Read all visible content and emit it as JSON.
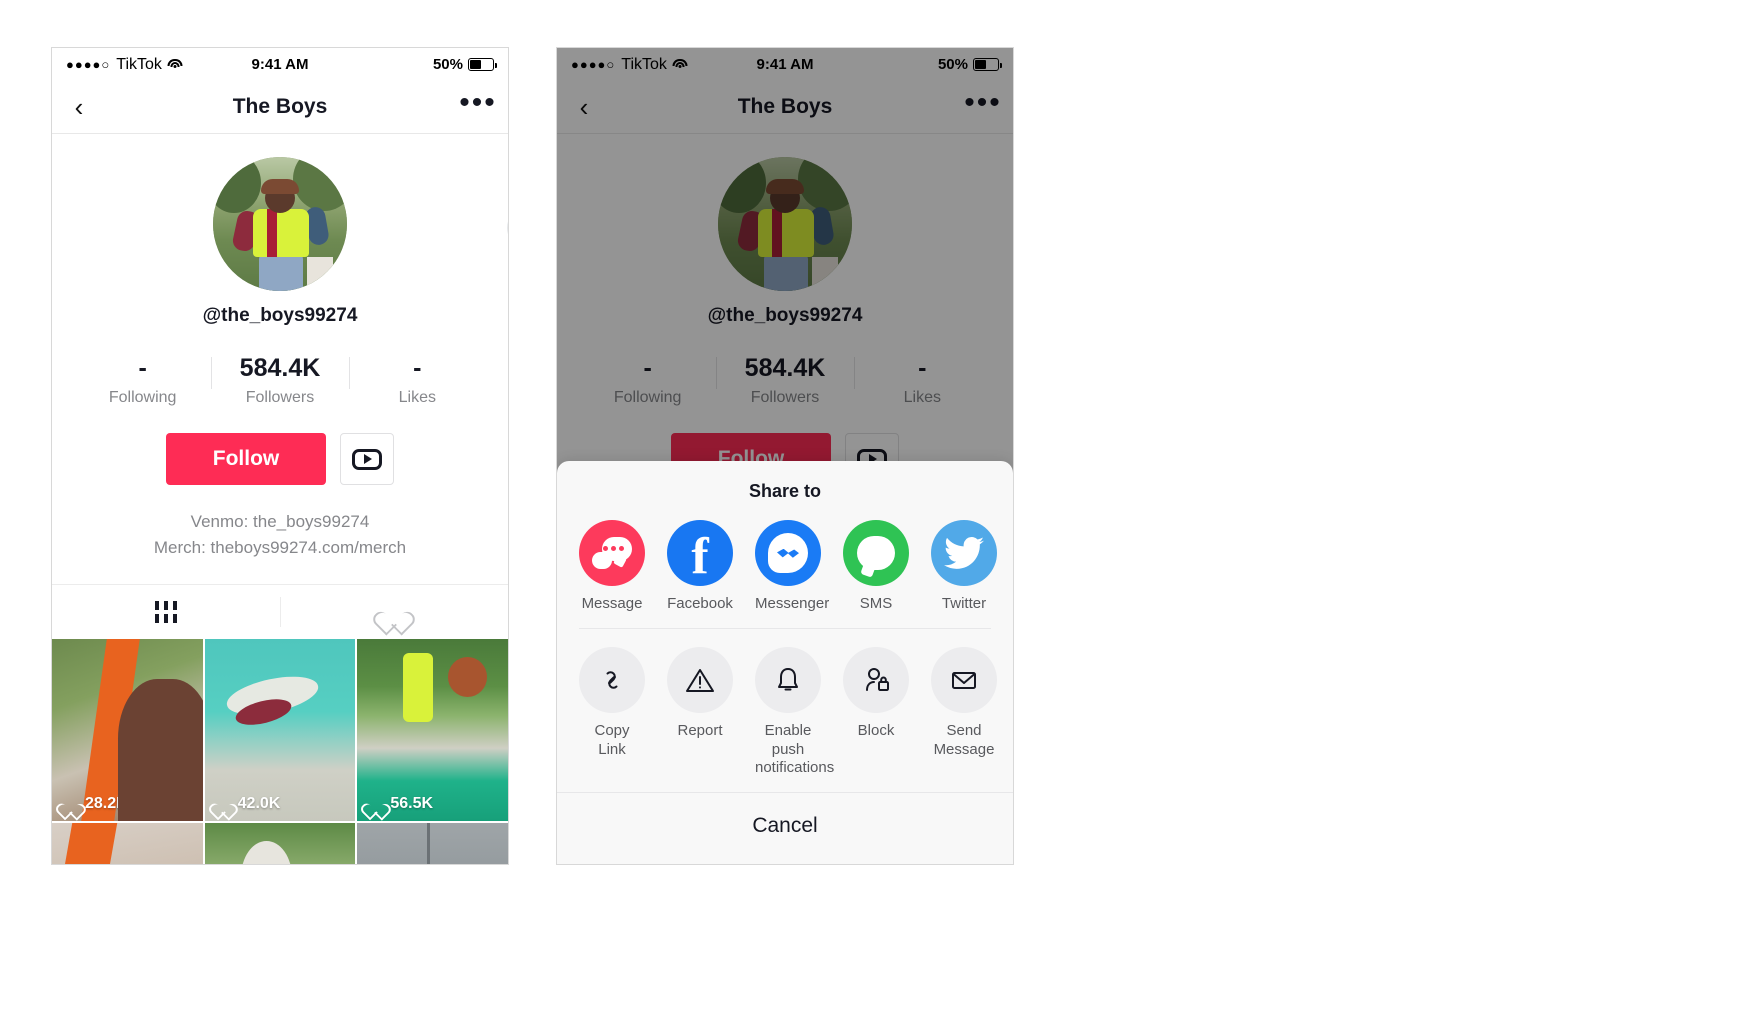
{
  "status_bar": {
    "signal_dots": "●●●●○",
    "carrier": "TikTok",
    "wifi_icon": "wifi-icon",
    "time": "9:41 AM",
    "battery_text": "50%",
    "battery_level": 50
  },
  "nav": {
    "back_icon": "chevron-left-icon",
    "title": "The Boys",
    "more_icon": "more-horizontal-icon",
    "more_label": "•••"
  },
  "profile": {
    "avatar_alt": "profile-photo",
    "handle": "@the_boys99274",
    "stats": [
      {
        "value": "-",
        "label": "Following"
      },
      {
        "value": "584.4K",
        "label": "Followers"
      },
      {
        "value": "-",
        "label": "Likes"
      }
    ],
    "follow_label": "Follow",
    "youtube_icon": "youtube-play-icon",
    "bio_line1": "Venmo: the_boys99274",
    "bio_line2": "Merch: theboys99274.com/merch",
    "tabs": [
      {
        "icon": "grid-icon",
        "active": true
      },
      {
        "icon": "heart-icon",
        "active": false
      }
    ]
  },
  "videos": [
    {
      "likes": "28.2K",
      "heart_icon": "heart-icon"
    },
    {
      "likes": "42.0K",
      "heart_icon": "heart-icon"
    },
    {
      "likes": "56.5K",
      "heart_icon": "heart-icon"
    },
    {
      "likes": "",
      "heart_icon": "heart-icon"
    },
    {
      "likes": "",
      "heart_icon": "heart-icon"
    },
    {
      "likes": "",
      "heart_icon": "heart-icon"
    }
  ],
  "share_sheet": {
    "title": "Share to",
    "share_targets": [
      {
        "label": "Message",
        "icon": "imessage-icon",
        "color": "#fd3a5c"
      },
      {
        "label": "Facebook",
        "icon": "facebook-icon",
        "color": "#1877f2"
      },
      {
        "label": "Messenger",
        "icon": "messenger-icon",
        "color": "#1a7bf5"
      },
      {
        "label": "SMS",
        "icon": "sms-icon",
        "color": "#2fc354"
      },
      {
        "label": "Twitter",
        "icon": "twitter-icon",
        "color": "#51a9e8"
      },
      {
        "label": "",
        "icon": "whatsapp-icon",
        "color": "#25d366"
      }
    ],
    "actions": [
      {
        "label": "Copy Link",
        "icon": "link-icon"
      },
      {
        "label": "Report",
        "icon": "warning-triangle-icon"
      },
      {
        "label": "Enable push notifications",
        "icon": "bell-icon"
      },
      {
        "label": "Block",
        "icon": "block-user-icon"
      },
      {
        "label": "Send Message",
        "icon": "envelope-icon"
      }
    ],
    "cancel_label": "Cancel"
  },
  "colors": {
    "accent_pink": "#fe2c55",
    "text_dark": "#161823",
    "text_muted": "#86878b",
    "sheet_bg": "#f8f8f8"
  },
  "cursors": [
    {
      "name": "pointing-hand-more-button"
    },
    {
      "name": "pointing-hand-block-button"
    }
  ]
}
